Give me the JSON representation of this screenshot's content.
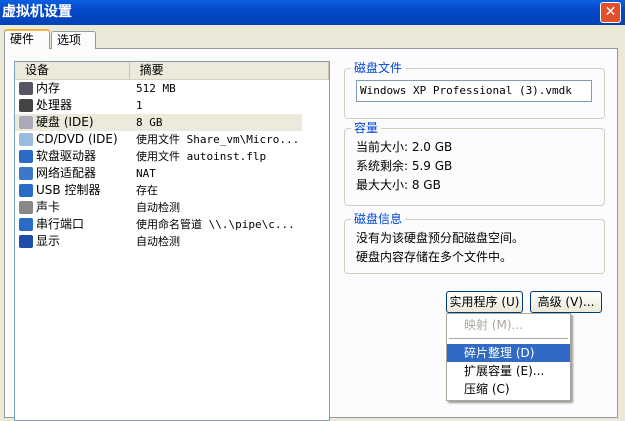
{
  "window": {
    "title": "虚拟机设置",
    "close": "✕"
  },
  "tabs": [
    {
      "label": "硬件"
    },
    {
      "label": "选项"
    }
  ],
  "devices": {
    "headers": [
      "设备",
      "摘要"
    ],
    "rows": [
      {
        "name": "内存",
        "summary": "512 MB",
        "icon": "memory-icon",
        "color": "#556"
      },
      {
        "name": "处理器",
        "summary": "1",
        "icon": "cpu-icon",
        "color": "#444"
      },
      {
        "name": "硬盘 (IDE)",
        "summary": "8 GB",
        "icon": "hard-disk-icon",
        "color": "#aab"
      },
      {
        "name": "CD/DVD (IDE)",
        "summary": "使用文件 Share_vm\\Micro...",
        "icon": "cd-icon",
        "color": "#9bd"
      },
      {
        "name": "软盘驱动器",
        "summary": "使用文件 autoinst.flp",
        "icon": "floppy-icon",
        "color": "#2a6bc9"
      },
      {
        "name": "网络适配器",
        "summary": "NAT",
        "icon": "network-icon",
        "color": "#3a78c8"
      },
      {
        "name": "USB 控制器",
        "summary": "存在",
        "icon": "usb-icon",
        "color": "#2a6bc9"
      },
      {
        "name": "声卡",
        "summary": "自动检测",
        "icon": "speaker-icon",
        "color": "#888"
      },
      {
        "name": "串行端口",
        "summary": "使用命名管道 \\\\.\\pipe\\c...",
        "icon": "serial-port-icon",
        "color": "#2a6bc9"
      },
      {
        "name": "显示",
        "summary": "自动检测",
        "icon": "display-icon",
        "color": "#1d4fa8"
      }
    ]
  },
  "disk_file": {
    "label": "磁盘文件",
    "value": "Windows XP Professional (3).vmdk"
  },
  "capacity": {
    "label": "容量",
    "current": "当前大小: 2.0 GB",
    "free": "系统剩余: 5.9 GB",
    "max": "最大大小: 8 GB"
  },
  "disk_info": {
    "label": "磁盘信息",
    "line1": "没有为该硬盘预分配磁盘空间。",
    "line2": "硬盘内容存储在多个文件中。"
  },
  "buttons": {
    "utilities": "实用程序 (U)",
    "advanced": "高级 (V)..."
  },
  "menu": {
    "map": "映射 (M)...",
    "defrag": "碎片整理 (D)",
    "expand": "扩展容量 (E)...",
    "compact": "压缩 (C)"
  }
}
